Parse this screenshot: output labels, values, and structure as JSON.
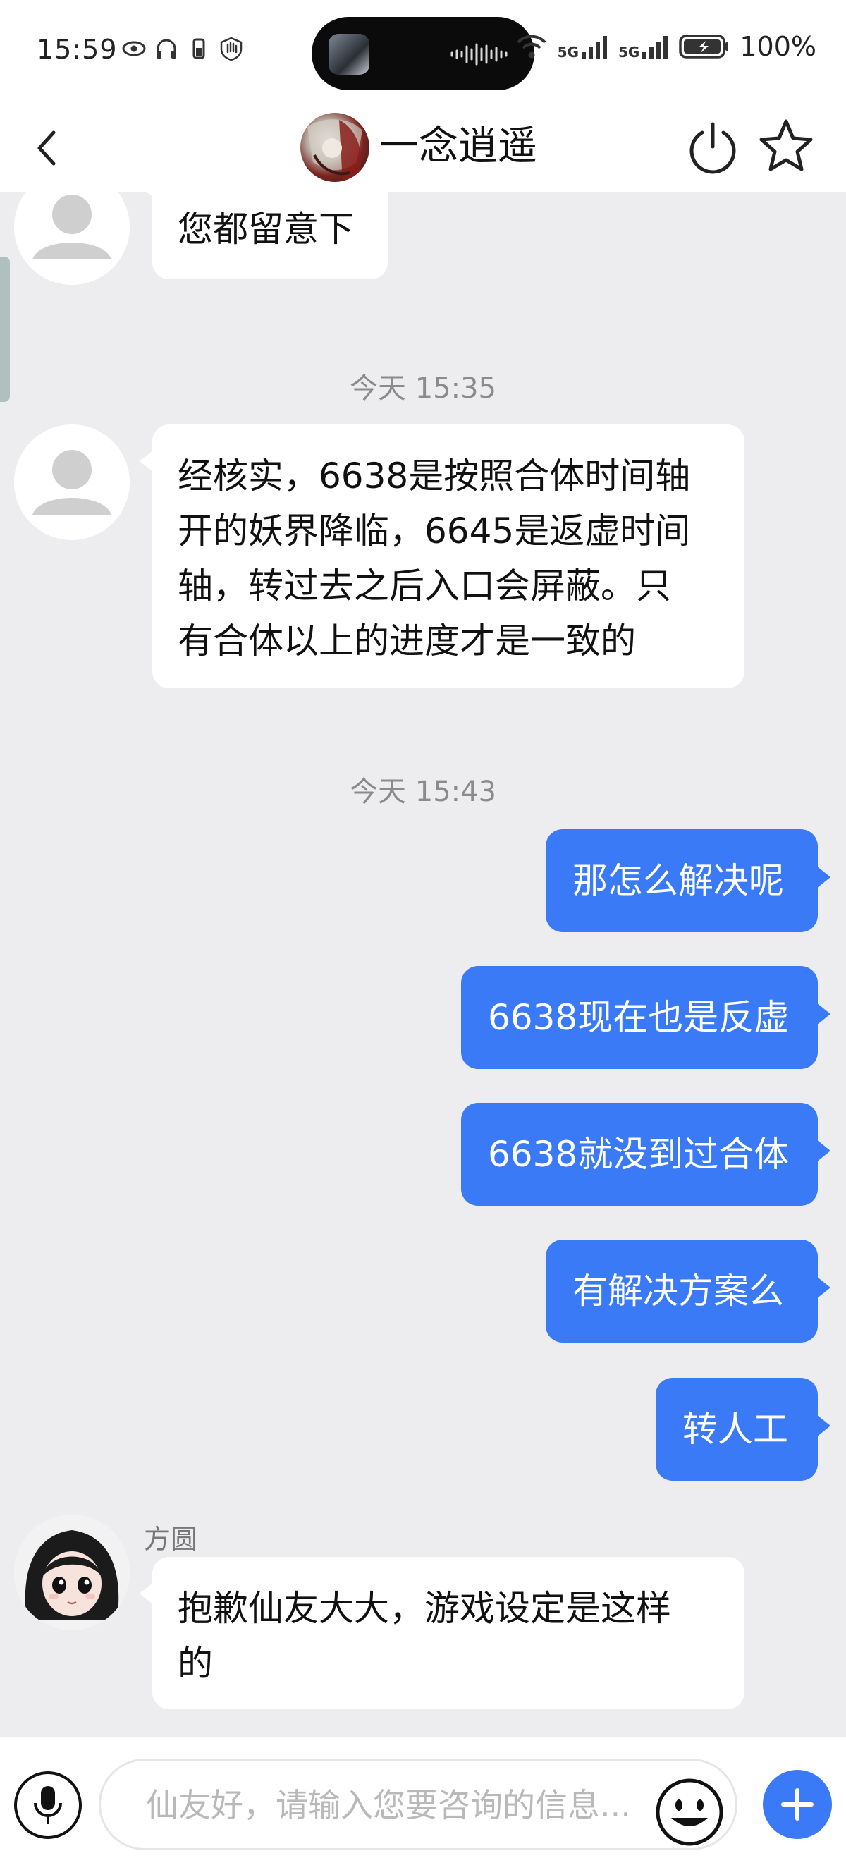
{
  "status_bar": {
    "time": "15:59",
    "battery_percent": "100%",
    "network_1": "5G",
    "network_2": "5G",
    "icons": [
      "eye-icon",
      "headphones-icon",
      "battery-saver-icon",
      "hand-icon",
      "wifi-icon",
      "signal-icon",
      "battery-icon"
    ]
  },
  "header": {
    "title": "一念逍遥",
    "icons": [
      "back-icon",
      "power-icon",
      "star-icon"
    ]
  },
  "messages": [
    {
      "type": "incoming",
      "text": "您都留意下"
    },
    {
      "type": "timestamp",
      "text": "今天 15:35"
    },
    {
      "type": "incoming",
      "lines": [
        "经核实，6638是按照合体时间轴",
        "开的妖界降临，6645是返虚时间",
        "轴，转过去之后入口会屏蔽。只",
        "有合体以上的进度才是一致的"
      ]
    },
    {
      "type": "timestamp",
      "text": "今天 15:43"
    },
    {
      "type": "outgoing",
      "text": "那怎么解决呢"
    },
    {
      "type": "outgoing",
      "text": "6638现在也是反虚"
    },
    {
      "type": "outgoing",
      "text": "6638就没到过合体"
    },
    {
      "type": "outgoing",
      "text": "有解决方案么"
    },
    {
      "type": "outgoing",
      "text": "转人工"
    },
    {
      "type": "incoming",
      "sender": "方圆",
      "lines": [
        "抱歉仙友大大，游戏设定是这样",
        "的"
      ]
    }
  ],
  "input_bar": {
    "placeholder": "仙友好，请输入您要咨询的信息...",
    "value": ""
  },
  "colors": {
    "accent": "#3a7af6",
    "background": "#ededf0",
    "bubble_in": "#ffffff",
    "timestamp_text": "#8b8b8b"
  }
}
